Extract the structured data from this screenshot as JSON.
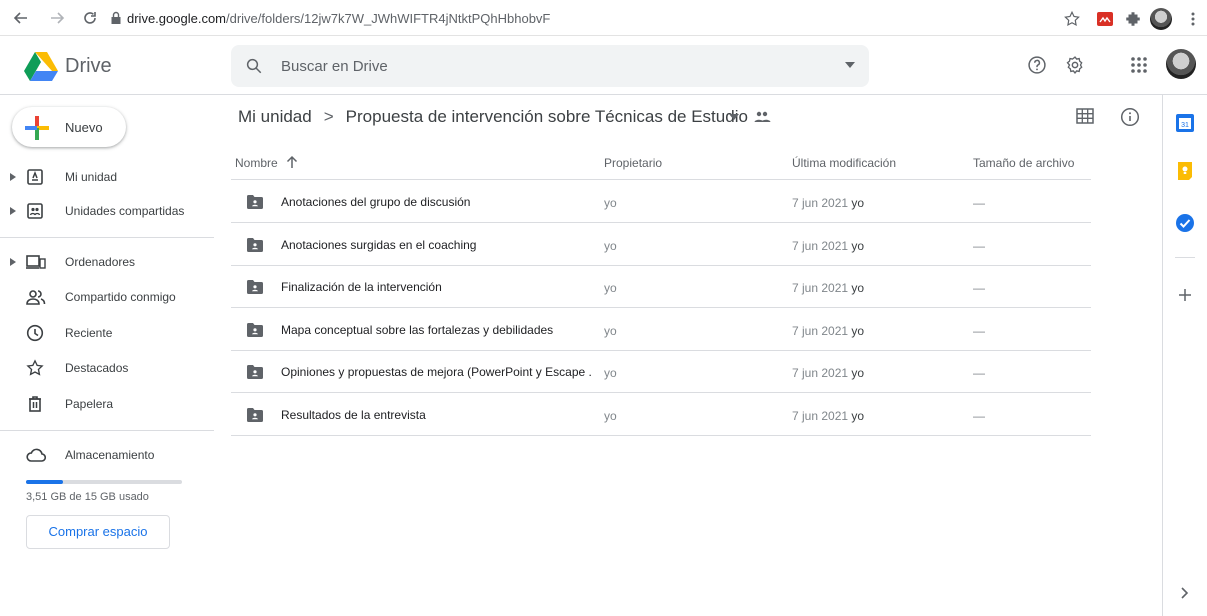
{
  "browser": {
    "url_host": "drive.google.com",
    "url_path": "/drive/folders/12jw7k7W_JWhWIFTR4jNtktPQhHbhobvF"
  },
  "header": {
    "brand": "Drive",
    "search_placeholder": "Buscar en Drive"
  },
  "sidebar": {
    "new_label": "Nuevo",
    "items_top": [
      {
        "label": "Mi unidad",
        "icon": "drive-icon"
      },
      {
        "label": "Unidades compartidas",
        "icon": "shared-drives-icon"
      }
    ],
    "items_mid": [
      {
        "label": "Ordenadores",
        "icon": "computers-icon"
      },
      {
        "label": "Compartido conmigo",
        "icon": "shared-with-me-icon"
      },
      {
        "label": "Reciente",
        "icon": "clock-icon"
      },
      {
        "label": "Destacados",
        "icon": "star-icon"
      },
      {
        "label": "Papelera",
        "icon": "trash-icon"
      }
    ],
    "storage": {
      "label": "Almacenamiento",
      "used_text": "3,51 GB de 15 GB usado",
      "used_fraction": 0.234,
      "buy_label": "Comprar espacio"
    }
  },
  "breadcrumb": {
    "root": "Mi unidad",
    "separator": ">",
    "current": "Propuesta de intervención sobre Técnicas de Estudio"
  },
  "table": {
    "columns": {
      "name": "Nombre",
      "owner": "Propietario",
      "modified": "Última modificación",
      "size": "Tamaño de archivo"
    },
    "rows": [
      {
        "name": "Anotaciones del grupo de discusión",
        "owner": "yo",
        "date": "7 jun 2021",
        "by": "yo",
        "size": "—"
      },
      {
        "name": "Anotaciones surgidas en el coaching",
        "owner": "yo",
        "date": "7 jun 2021",
        "by": "yo",
        "size": "—"
      },
      {
        "name": "Finalización de la intervención",
        "owner": "yo",
        "date": "7 jun 2021",
        "by": "yo",
        "size": "—"
      },
      {
        "name": "Mapa conceptual sobre las fortalezas y debilidades",
        "owner": "yo",
        "date": "7 jun 2021",
        "by": "yo",
        "size": "—"
      },
      {
        "name": "Opiniones y propuestas de mejora (PowerPoint y Escape ...",
        "owner": "yo",
        "date": "7 jun 2021",
        "by": "yo",
        "size": "—"
      },
      {
        "name": "Resultados de la entrevista",
        "owner": "yo",
        "date": "7 jun 2021",
        "by": "yo",
        "size": "—"
      }
    ]
  },
  "colors": {
    "accent": "#1a73e8",
    "folder": "#5f6368",
    "calendar": "#1a73e8",
    "keep": "#fbbc04",
    "tasks": "#1a73e8"
  }
}
